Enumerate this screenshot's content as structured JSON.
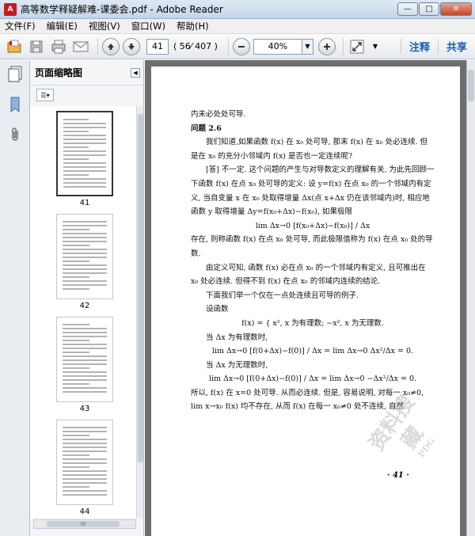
{
  "window": {
    "title": "高等数学释疑解难-课委会.pdf - Adobe Reader",
    "minimize": "—",
    "maximize": "□",
    "close": "✕"
  },
  "menu": {
    "items": [
      "文件(F)",
      "编辑(E)",
      "视图(V)",
      "窗口(W)",
      "帮助(H)"
    ]
  },
  "toolbar": {
    "page_number": "41",
    "page_count": "( 56⁄ 407 )",
    "zoom_value": "40%",
    "comment_label": "注释",
    "share_label": "共享"
  },
  "sidebar": {
    "panel_title": "页面缩略图",
    "thumbnails": [
      {
        "label": "41",
        "selected": true
      },
      {
        "label": "42",
        "selected": false
      },
      {
        "label": "43",
        "selected": false
      },
      {
        "label": "44",
        "selected": false
      }
    ],
    "scroll_grip": "III"
  },
  "document": {
    "line1": "内未必处处可导.",
    "heading": "问题 2.6",
    "para1": "我们知道,如果函数 f(x) 在 x₀ 处可导, 那末 f(x) 在 x₀ 处必连续. 但是在 x₀ 的充分小邻域内 f(x) 是否也一定连续呢?",
    "para2": "[答] 不一定. 这个问题的产生与对导数定义的理解有关, 为此先回顾一下函数 f(x) 在点 x₀ 处可导的定义: 设 y=f(x) 在点 x₀ 的一个邻域内有定义, 当自变量 x 在 x₀ 处取得增量 Δx(点 x+Δx 仍在该邻域内)时, 相应地函数 y 取得增量 Δy=f(x₀+Δx)−f(x₀), 如果极限",
    "formula1": "lim Δx→0 [f(x₀+Δx)−f(x₀)] / Δx",
    "para3": "存在, 则称函数 f(x) 在点 x₀ 处可导, 而此极限值称为 f(x) 在点 x₀ 处的导数.",
    "para4": "由定义可知, 函数 f(x) 必在点 x₀ 的一个邻域内有定义, 且可推出在 x₀ 处必连续. 但得不到 f(x) 在点 x₀ 的邻域内连续的结论.",
    "para5": "下面我们举一个仅在一点处连续且可导的例子.",
    "para6": "设函数",
    "formula2": "f(x) = { x², x 为有理数;  −x², x 为无理数.",
    "para7": "当 Δx 为有理数时,",
    "formula3": "lim Δx→0 [f(0+Δx)−f(0)] / Δx = lim Δx→0 Δx²/Δx = 0.",
    "para8": "当 Δx 为无理数时,",
    "formula4": "lim Δx→0 [f(0+Δx)−f(0)] / Δx = lim Δx→0 −Δx²/Δx = 0.",
    "para9": "所以, f(x) 在 x=0 处可导. 从而必连续. 但是, 容易说明, 对每一 x₀≠0, lim x→x₀ f(x) 均不存在, 从而 f(x) 在每一 x₀≠0 处不连续, 自然",
    "page_footer": "· 41 ·",
    "watermark": "资料搜藏",
    "watermark_sub": "PDG"
  },
  "icons": {
    "open": "folder-open-icon",
    "save": "save-icon",
    "print": "print-icon",
    "email": "email-icon",
    "prev": "arrow-up-icon",
    "next": "arrow-down-icon",
    "zoom_out": "minus-icon",
    "zoom_in": "plus-icon",
    "fit": "fit-page-icon",
    "thumbnails": "pages-icon",
    "bookmarks": "bookmark-icon",
    "attachments": "paperclip-icon"
  },
  "colors": {
    "accent": "#1b5fb4",
    "title_bar": "#c4d4e8",
    "doc_background": "#6d6d6d",
    "close_button": "#c4472d"
  }
}
